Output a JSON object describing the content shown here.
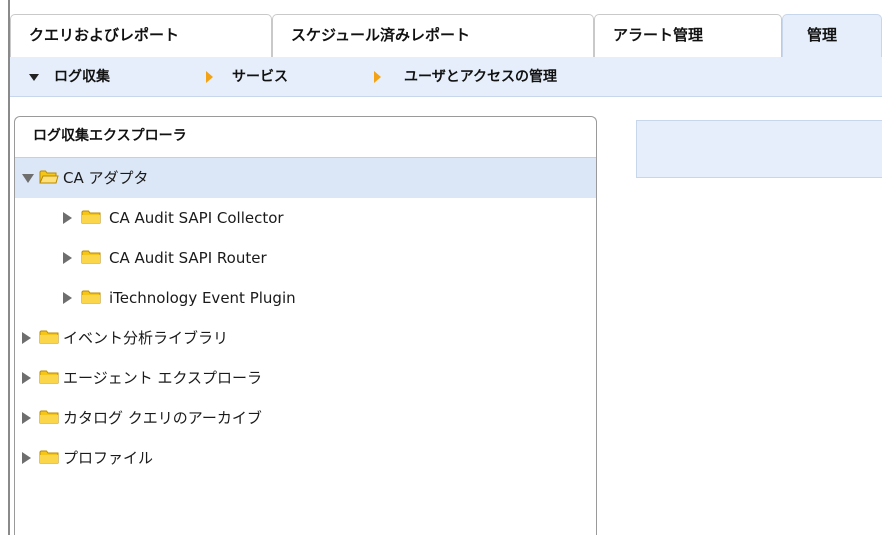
{
  "tabs": [
    {
      "label": "クエリおよびレポート",
      "active": false
    },
    {
      "label": "スケジュール済みレポート",
      "active": false
    },
    {
      "label": "アラート管理",
      "active": false
    },
    {
      "label": "管理",
      "active": true
    }
  ],
  "subnav": {
    "items": [
      {
        "label": "ログ収集"
      },
      {
        "label": "サービス"
      },
      {
        "label": "ユーザとアクセスの管理"
      }
    ]
  },
  "explorer": {
    "title": "ログ収集エクスプローラ",
    "tree": [
      {
        "label": "CA アダプタ",
        "expanded": true,
        "selected": true,
        "level": 0
      },
      {
        "label": "CA Audit SAPI Collector",
        "expanded": false,
        "level": 1
      },
      {
        "label": "CA Audit SAPI Router",
        "expanded": false,
        "level": 1
      },
      {
        "label": "iTechnology Event Plugin",
        "expanded": false,
        "level": 1
      },
      {
        "label": "イベント分析ライブラリ",
        "expanded": false,
        "level": 0
      },
      {
        "label": "エージェント エクスプローラ",
        "expanded": false,
        "level": 0
      },
      {
        "label": "カタログ クエリのアーカイブ",
        "expanded": false,
        "level": 0
      },
      {
        "label": "プロファイル",
        "expanded": false,
        "level": 0
      }
    ]
  },
  "colors": {
    "accent_bg": "#e5eefa",
    "selected_row": "#dbe6f6",
    "separator_arrow": "#f2a214",
    "folder": "#f5c518"
  },
  "icons": {
    "folder": "folder-icon",
    "expand": "triangle-right-icon",
    "collapse": "triangle-down-icon"
  }
}
